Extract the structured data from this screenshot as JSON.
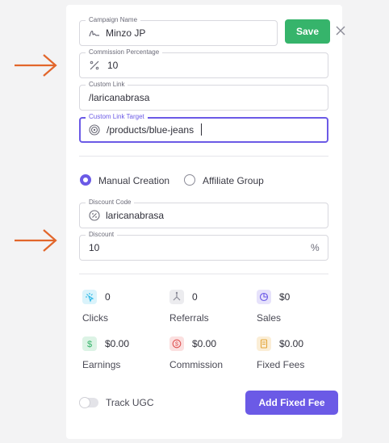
{
  "form": {
    "campaign_name": {
      "label": "Campaign Name",
      "value": "Minzo JP"
    },
    "save_label": "Save",
    "commission": {
      "label": "Commission Percentage",
      "value": "10"
    },
    "custom_link": {
      "label": "Custom Link",
      "value": "/laricanabrasa"
    },
    "custom_link_target": {
      "label": "Custom Link Target",
      "value": "/products/blue-jeans"
    },
    "discount_mode": {
      "options": [
        "Manual Creation",
        "Affiliate Group"
      ],
      "selected": "Manual Creation"
    },
    "discount_code": {
      "label": "Discount Code",
      "value": "laricanabrasa"
    },
    "discount": {
      "label": "Discount",
      "value": "10",
      "suffix": "%"
    }
  },
  "stats": [
    {
      "icon": "clicks-icon",
      "value": "0",
      "label": "Clicks",
      "color": "#27b6e6"
    },
    {
      "icon": "referrals-icon",
      "value": "0",
      "label": "Referrals",
      "color": "#8a8a96"
    },
    {
      "icon": "sales-icon",
      "value": "$0",
      "label": "Sales",
      "color": "#6b5ae6"
    },
    {
      "icon": "earnings-icon",
      "value": "$0.00",
      "label": "Earnings",
      "color": "#36b46b"
    },
    {
      "icon": "commission-icon",
      "value": "$0.00",
      "label": "Commission",
      "color": "#e05555"
    },
    {
      "icon": "fixed-fees-icon",
      "value": "$0.00",
      "label": "Fixed Fees",
      "color": "#e3a53a"
    }
  ],
  "footer": {
    "track_ugc_label": "Track UGC",
    "track_ugc_enabled": false,
    "add_fixed_fee_label": "Add Fixed Fee"
  },
  "colors": {
    "accent": "#6b5ae6",
    "save": "#36b46b",
    "arrow": "#e2662b"
  }
}
